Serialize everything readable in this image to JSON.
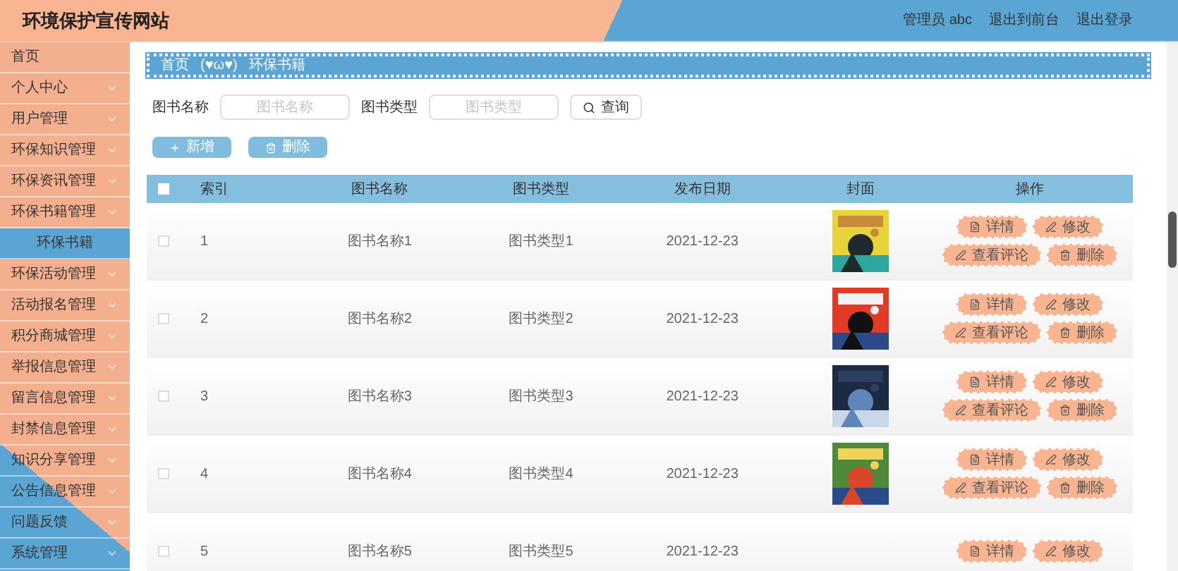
{
  "header": {
    "title": "环境保护宣传网站",
    "user": "管理员 abc",
    "links": [
      "退出到前台",
      "退出登录"
    ]
  },
  "sidebar": {
    "items": [
      {
        "label": "首页",
        "expandable": false,
        "selected": false
      },
      {
        "label": "个人中心",
        "expandable": true,
        "selected": false
      },
      {
        "label": "用户管理",
        "expandable": true,
        "selected": false
      },
      {
        "label": "环保知识管理",
        "expandable": true,
        "selected": false
      },
      {
        "label": "环保资讯管理",
        "expandable": true,
        "selected": false
      },
      {
        "label": "环保书籍管理",
        "expandable": true,
        "selected": false,
        "children": [
          {
            "label": "环保书籍",
            "selected": true
          }
        ]
      },
      {
        "label": "环保活动管理",
        "expandable": true,
        "selected": false
      },
      {
        "label": "活动报名管理",
        "expandable": true,
        "selected": false
      },
      {
        "label": "积分商城管理",
        "expandable": true,
        "selected": false
      },
      {
        "label": "举报信息管理",
        "expandable": true,
        "selected": false
      },
      {
        "label": "留言信息管理",
        "expandable": true,
        "selected": false
      },
      {
        "label": "封禁信息管理",
        "expandable": true,
        "selected": false
      },
      {
        "label": "知识分享管理",
        "expandable": true,
        "selected": false
      },
      {
        "label": "公告信息管理",
        "expandable": true,
        "selected": false
      },
      {
        "label": "问题反馈",
        "expandable": true,
        "selected": false
      },
      {
        "label": "系统管理",
        "expandable": true,
        "selected": false
      }
    ]
  },
  "breadcrumb": [
    "首页",
    "(♥ω♥)",
    "环保书籍"
  ],
  "search": {
    "fields": [
      {
        "label": "图书名称",
        "placeholder": "图书名称"
      },
      {
        "label": "图书类型",
        "placeholder": "图书类型"
      }
    ],
    "button": "查询"
  },
  "toolbar": [
    {
      "kind": "add",
      "label": "新增"
    },
    {
      "kind": "delete",
      "label": "删除"
    }
  ],
  "table": {
    "columns": [
      "索引",
      "图书名称",
      "图书类型",
      "发布日期",
      "封面",
      "操作"
    ],
    "header_checked": false,
    "rows": [
      {
        "checked": false,
        "cells": [
          "1",
          "图书名称1",
          "图书类型1",
          "2021-12-23"
        ],
        "cover": {
          "kind": "picture"
        },
        "actions": [
          {
            "kind": "detail",
            "label": "详情"
          },
          {
            "kind": "edit",
            "label": "修改"
          },
          {
            "kind": "comments",
            "label": "查看评论"
          },
          {
            "kind": "delete",
            "label": "删除"
          }
        ]
      },
      {
        "checked": false,
        "cells": [
          "2",
          "图书名称2",
          "图书类型2",
          "2021-12-23"
        ],
        "cover": {
          "kind": "picture"
        },
        "actions": [
          {
            "kind": "detail",
            "label": "详情"
          },
          {
            "kind": "edit",
            "label": "修改"
          },
          {
            "kind": "comments",
            "label": "查看评论"
          },
          {
            "kind": "delete",
            "label": "删除"
          }
        ]
      },
      {
        "checked": false,
        "cells": [
          "3",
          "图书名称3",
          "图书类型3",
          "2021-12-23"
        ],
        "cover": {
          "kind": "picture"
        },
        "actions": [
          {
            "kind": "detail",
            "label": "详情"
          },
          {
            "kind": "edit",
            "label": "修改"
          },
          {
            "kind": "comments",
            "label": "查看评论"
          },
          {
            "kind": "delete",
            "label": "删除"
          }
        ]
      },
      {
        "checked": false,
        "cells": [
          "4",
          "图书名称4",
          "图书类型4",
          "2021-12-23"
        ],
        "cover": {
          "kind": "picture"
        },
        "actions": [
          {
            "kind": "detail",
            "label": "详情"
          },
          {
            "kind": "edit",
            "label": "修改"
          },
          {
            "kind": "comments",
            "label": "查看评论"
          },
          {
            "kind": "delete",
            "label": "删除"
          }
        ]
      },
      {
        "checked": false,
        "cells": [
          "5",
          "图书名称5",
          "图书类型5",
          "2021-12-23"
        ],
        "actions": [
          {
            "kind": "detail",
            "label": "详情"
          },
          {
            "kind": "edit",
            "label": "修改"
          }
        ]
      }
    ]
  }
}
